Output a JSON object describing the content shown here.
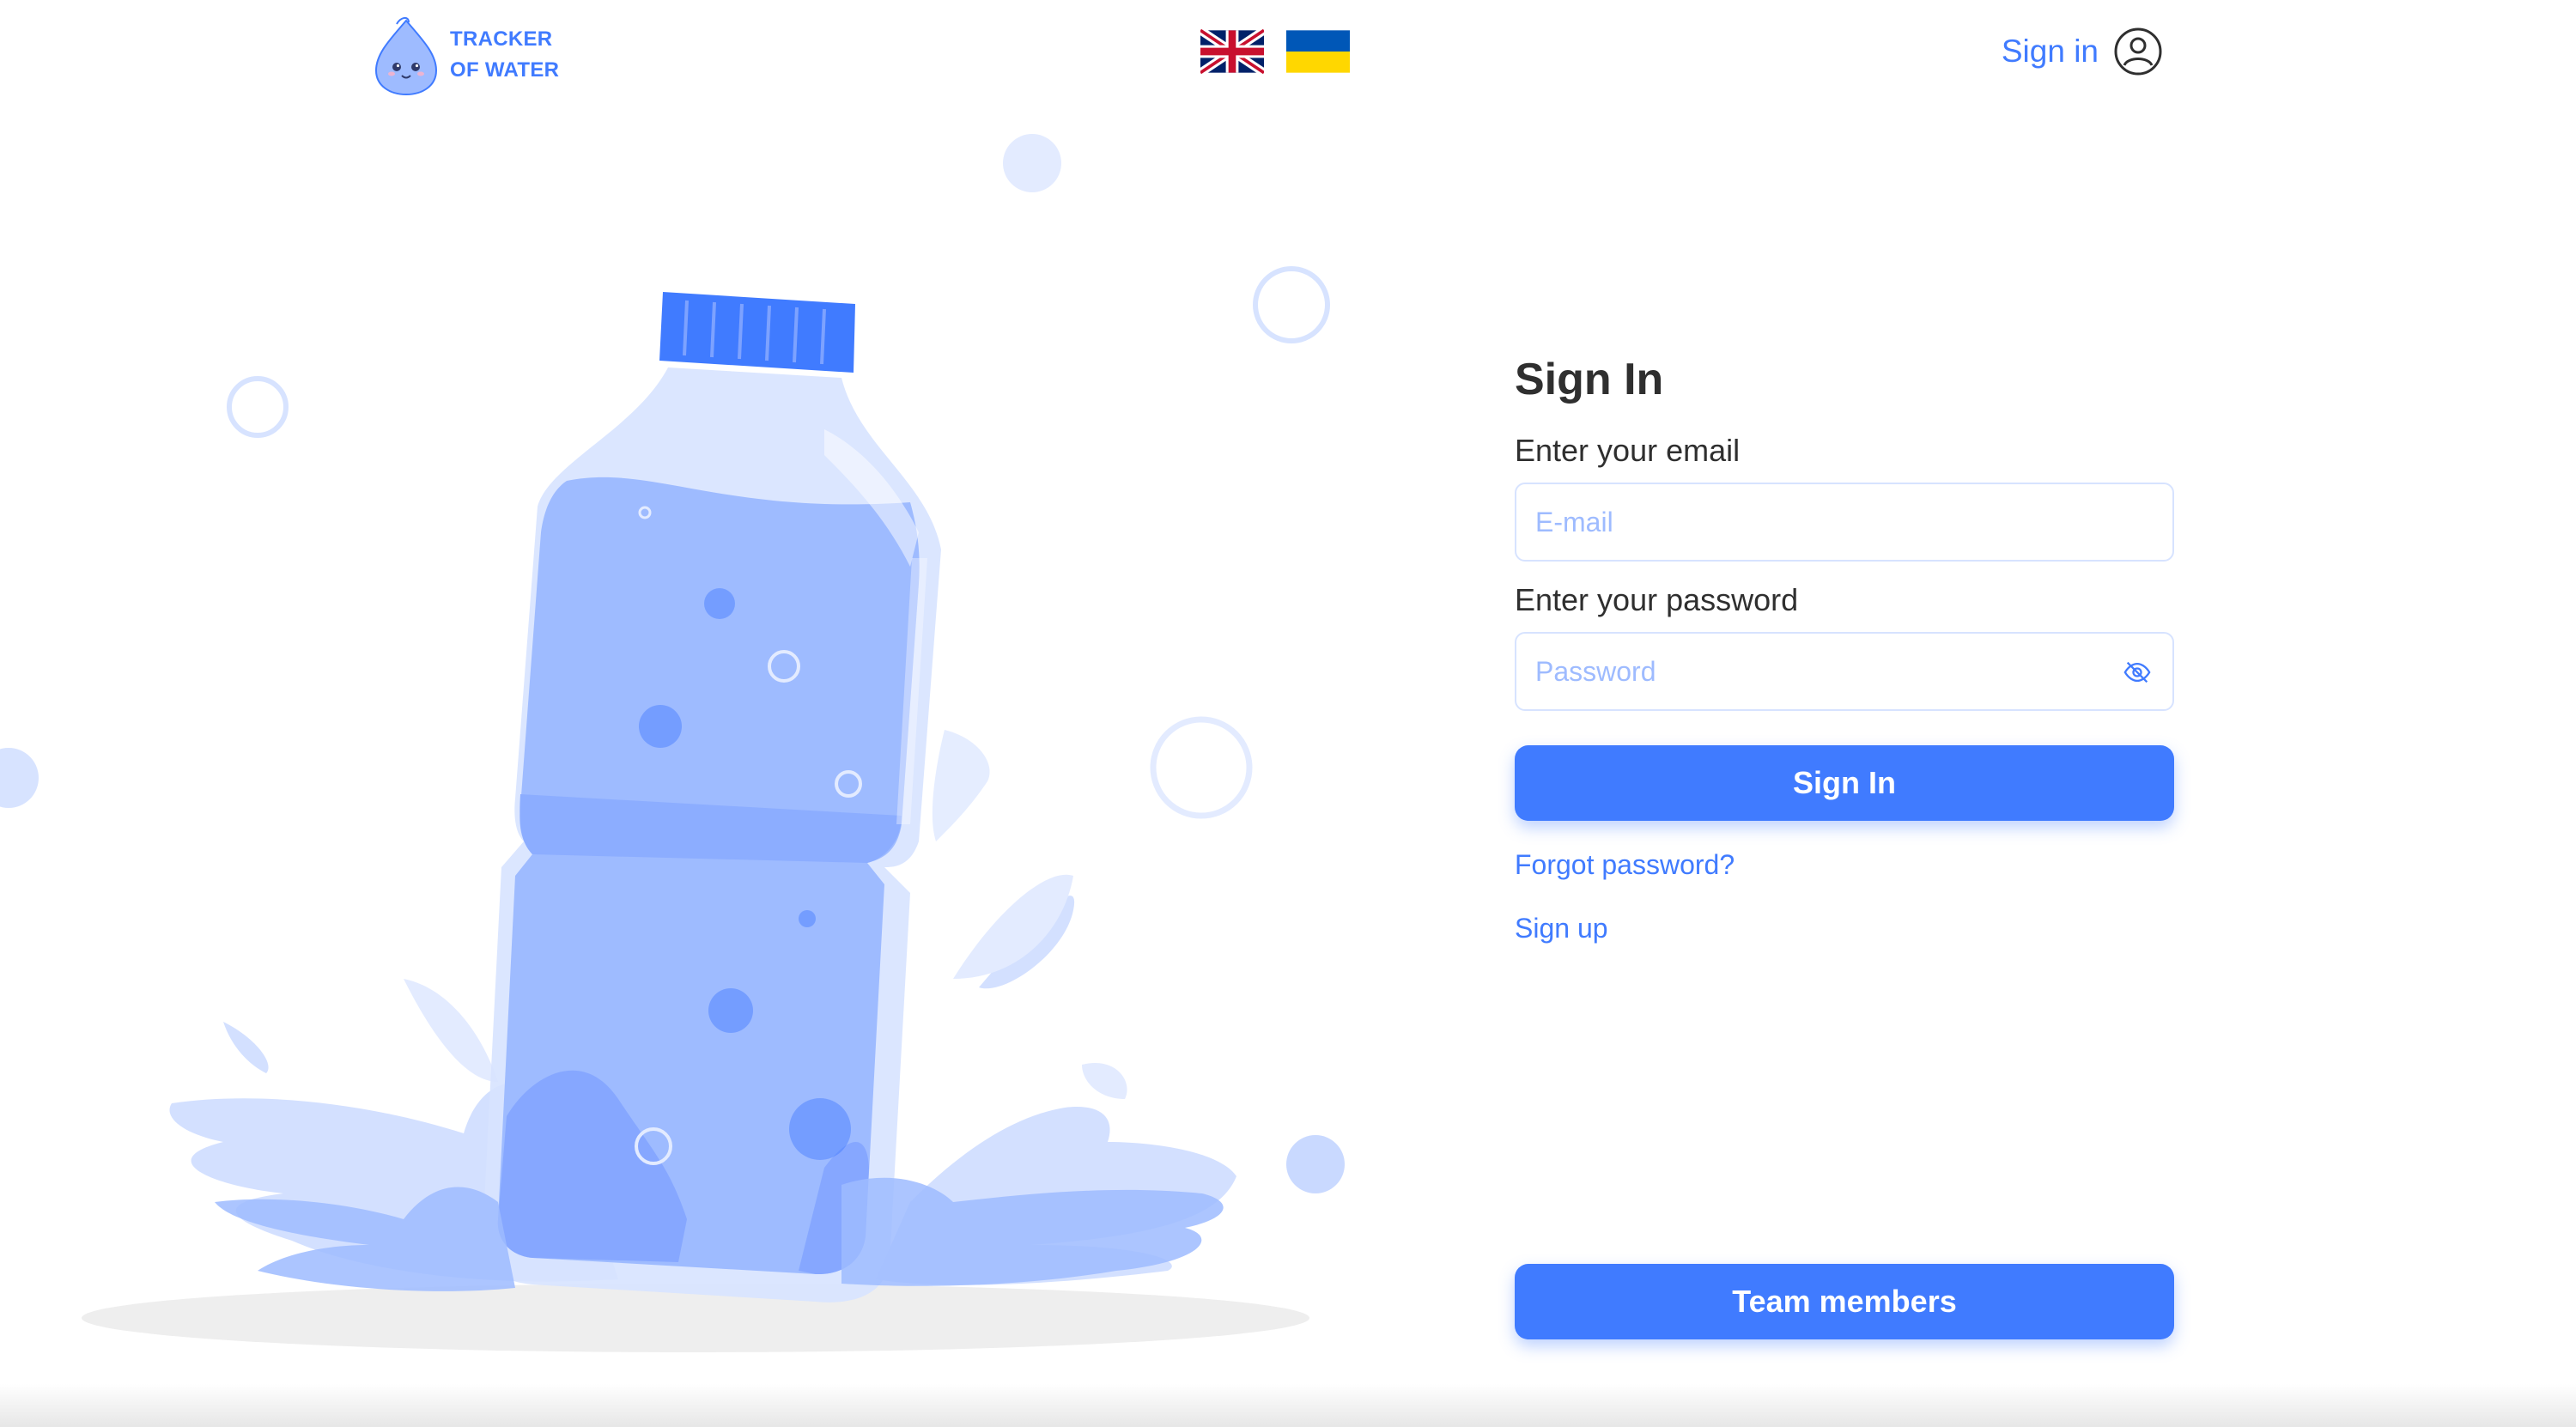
{
  "header": {
    "logo": {
      "line1": "TRACKER",
      "line2": "OF WATER"
    },
    "languages": [
      {
        "code": "en",
        "icon": "uk-flag-icon"
      },
      {
        "code": "uk",
        "icon": "ukraine-flag-icon"
      }
    ],
    "sign_in_label": "Sign in",
    "user_icon": "user-circle-icon"
  },
  "form": {
    "title": "Sign In",
    "email_label": "Enter your email",
    "email_placeholder": "E-mail",
    "email_value": "",
    "password_label": "Enter your password",
    "password_placeholder": "Password",
    "password_value": "",
    "password_toggle_icon": "eye-off-icon",
    "submit_label": "Sign In",
    "forgot_label": "Forgot password?",
    "signup_label": "Sign up"
  },
  "team_button_label": "Team members",
  "colors": {
    "accent": "#407bff",
    "placeholder": "#9ebbff",
    "input_border": "#d7e3ff",
    "illustration": "#9ebbff",
    "text": "#2f2f2f"
  }
}
